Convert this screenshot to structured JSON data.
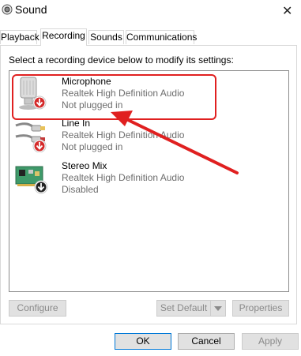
{
  "window": {
    "title": "Sound",
    "title_icon": "speaker-icon",
    "close_glyph": "✕"
  },
  "tabs": [
    {
      "label": "Playback"
    },
    {
      "label": "Recording"
    },
    {
      "label": "Sounds"
    },
    {
      "label": "Communications"
    }
  ],
  "active_tab": "Recording",
  "panel": {
    "instruction": "Select a recording device below to modify its settings:"
  },
  "devices": [
    {
      "name": "Microphone",
      "driver": "Realtek High Definition Audio",
      "status": "Not plugged in",
      "icon": "microphone-icon",
      "badge": "red-down-arrow-icon"
    },
    {
      "name": "Line In",
      "driver": "Realtek High Definition Audio",
      "status": "Not plugged in",
      "icon": "line-in-cable-icon",
      "badge": "red-down-arrow-icon"
    },
    {
      "name": "Stereo Mix",
      "driver": "Realtek High Definition Audio",
      "status": "Disabled",
      "icon": "sound-card-icon",
      "badge": "black-down-arrow-icon"
    }
  ],
  "buttons": {
    "configure": "Configure",
    "set_default": "Set Default",
    "properties": "Properties",
    "ok": "OK",
    "cancel": "Cancel",
    "apply": "Apply"
  },
  "colors": {
    "annotation_red": "#e02020",
    "focus_blue": "#0078d7",
    "secondary_text": "#6d6d6d"
  }
}
